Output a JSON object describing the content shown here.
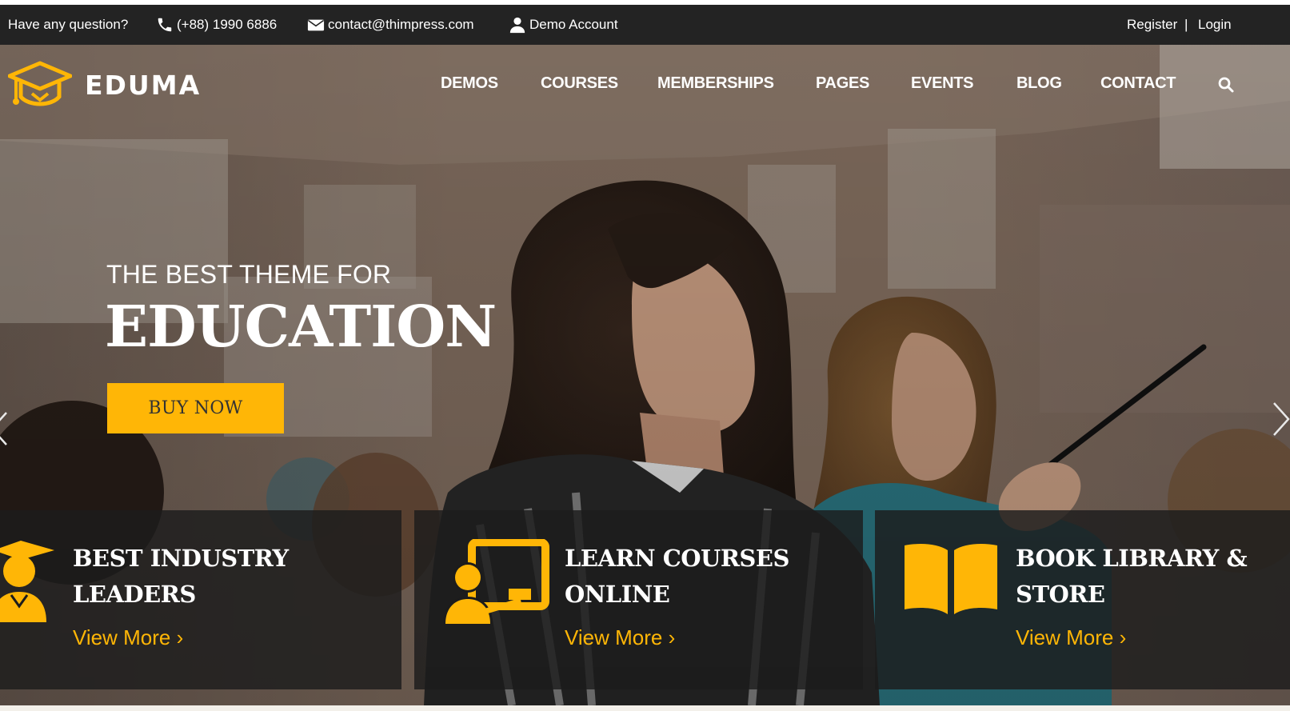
{
  "topbar": {
    "question": "Have any question?",
    "phone": "(+88) 1990 6886",
    "email": "contact@thimpress.com",
    "account": "Demo Account",
    "register": "Register",
    "separator": "|",
    "login": "Login",
    "icons": [
      "phone-icon",
      "envelope-icon",
      "user-icon"
    ]
  },
  "brand": {
    "name": "EDUMA",
    "logo_icon": "graduation-cap-icon",
    "accent": "#ffb606"
  },
  "nav": {
    "items": [
      "DEMOS",
      "COURSES",
      "MEMBERSHIPS",
      "PAGES",
      "EVENTS",
      "BLOG",
      "CONTACT"
    ],
    "search_icon": "search-icon"
  },
  "slide": {
    "subtitle": "THE BEST THEME FOR",
    "title": "EDUCATION",
    "button": "BUY NOW"
  },
  "features": [
    {
      "title_line1": "BEST INDUSTRY",
      "title_line2": "LEADERS",
      "link": "View More ›",
      "icon": "graduate-icon"
    },
    {
      "title_line1": "LEARN COURSES",
      "title_line2": "ONLINE",
      "link": "View More ›",
      "icon": "online-course-icon"
    },
    {
      "title_line1": "BOOK LIBRARY &",
      "title_line2": "STORE",
      "link": "View More ›",
      "icon": "book-icon"
    }
  ],
  "colors": {
    "topbar_bg": "#232323",
    "accent": "#ffb606",
    "feature_bg": "#1c1c1c"
  }
}
